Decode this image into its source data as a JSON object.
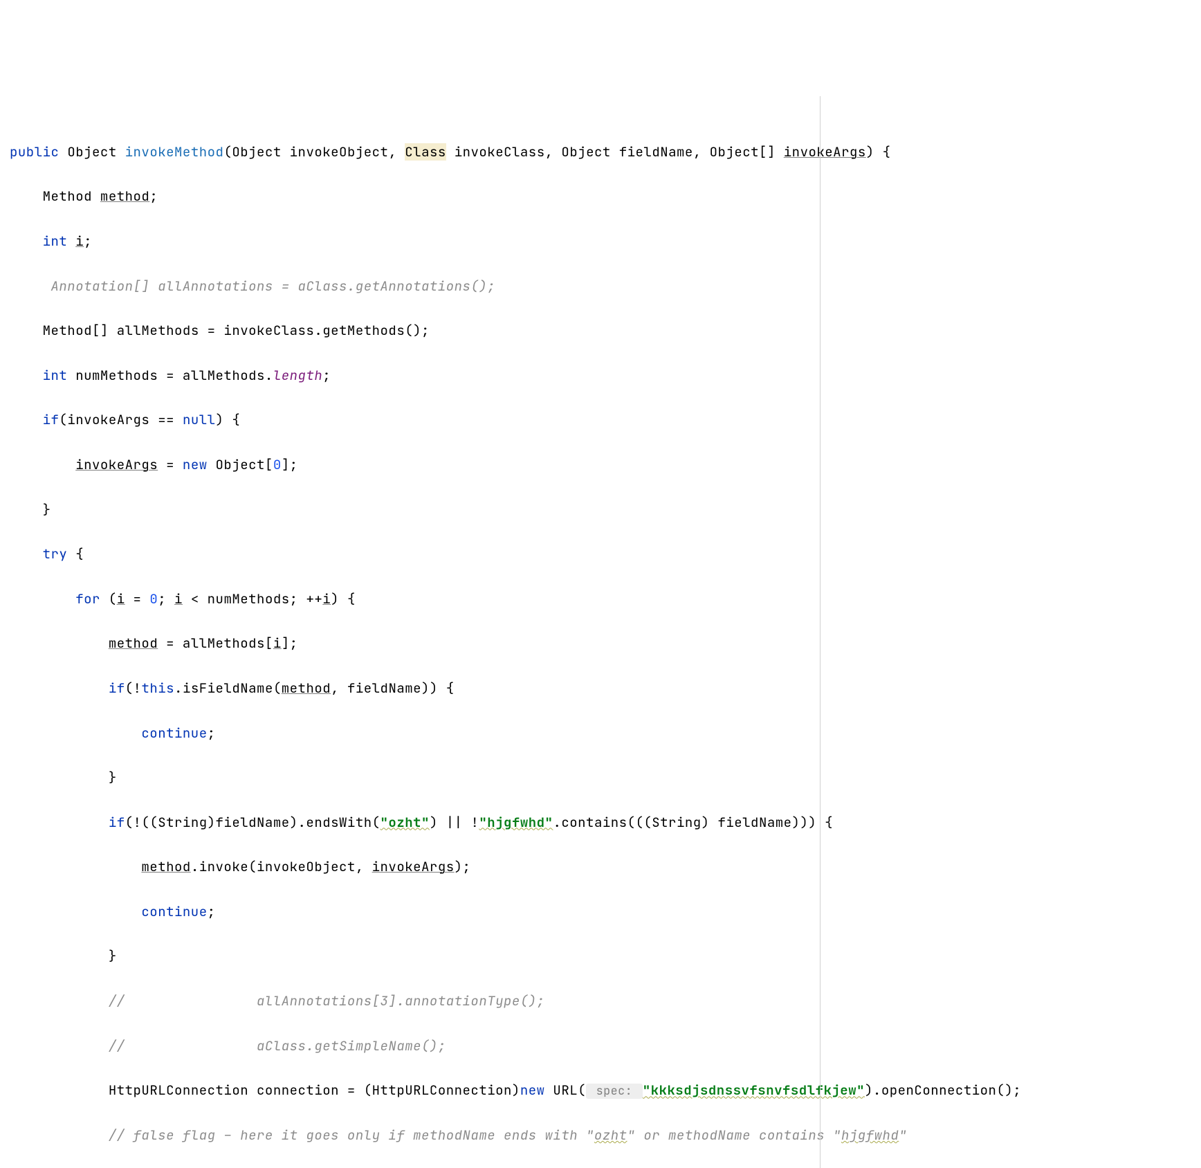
{
  "code": {
    "line1": {
      "kwPublic": "public",
      "typeObject1": "Object",
      "methodName": "invokeMethod",
      "typeObject2": "Object",
      "param1": "invokeObject",
      "typeClass": "Class",
      "param2": "invokeClass",
      "typeObject3": "Object",
      "param3": "fieldName",
      "typeObjectArr": "Object[]",
      "param4": "invokeArgs",
      "close": ") {"
    },
    "line2": {
      "typeMethod": "Method",
      "varMethod": "method",
      "semicolon": ";"
    },
    "line3": {
      "kwInt": "int",
      "varI": "i",
      "semicolon": ";"
    },
    "line4": {
      "comment": " Annotation[] allAnnotations = aClass.getAnnotations();"
    },
    "line5": {
      "typeMethodArr": "Method[]",
      "varAllMethods": "allMethods",
      "assign": " = invokeClass.getMethods();"
    },
    "line6": {
      "kwInt": "int",
      "varNumMethods": "numMethods",
      "assign": " = allMethods.",
      "fieldLength": "length",
      "semicolon": ";"
    },
    "line7": {
      "kwIf": "if",
      "expr": "(invokeArgs == ",
      "kwNull": "null",
      "close": ") {"
    },
    "line8": {
      "varInvokeArgs": "invokeArgs",
      "assign": " = ",
      "kwNew": "new",
      "typeObject": " Object[",
      "num": "0",
      "close": "];"
    },
    "line9": {
      "brace": "}"
    },
    "line10": {
      "kwTry": "try",
      "brace": " {"
    },
    "line11": {
      "kwFor": "for",
      "open": " (",
      "varI1": "i",
      "assign": " = ",
      "num0": "0",
      "semi1": "; ",
      "varI2": "i",
      "lt": " < numMethods; ++",
      "varI3": "i",
      "close": ") {"
    },
    "line12": {
      "varMethod": "method",
      "assign": " = allMethods[",
      "varI": "i",
      "close": "];"
    },
    "line13": {
      "kwIf": "if",
      "open": "(!",
      "kwThis": "this",
      "call": ".isFieldName(",
      "varMethod": "method",
      "comma": ", fieldName)) {"
    },
    "line14": {
      "kwContinue": "continue",
      "semicolon": ";"
    },
    "line15": {
      "brace": "}"
    },
    "line16": {
      "kwIf": "if",
      "expr1": "(!((String)fieldName).endsWith(",
      "str1": "\"ozht\"",
      "mid": ") || !",
      "str2": "\"hjgfwhd\"",
      "expr2": ".contains(((String) fieldName))) {"
    },
    "line17": {
      "varMethod": "method",
      "call": ".invoke(invokeObject, ",
      "varInvokeArgs": "invokeArgs",
      "close": ");"
    },
    "line18": {
      "kwContinue": "continue",
      "semicolon": ";"
    },
    "line19": {
      "brace": "}"
    },
    "line20": {
      "comment": "//                allAnnotations[3].annotationType();"
    },
    "line21": {
      "comment": "//                aClass.getSimpleName();"
    },
    "line22": {
      "text1": "HttpURLConnection connection = (HttpURLConnection)",
      "kwNew": "new",
      "text2": " URL(",
      "hint": " spec: ",
      "str": "\"kkksdjsdnssvfsnvfsdlfkjew\"",
      "text3": ").openConnection();"
    },
    "line23": {
      "comment": "// false flag - here it goes only if methodName ends with \"ozht\" or methodName contains \"hjgfwhd\""
    }
  }
}
